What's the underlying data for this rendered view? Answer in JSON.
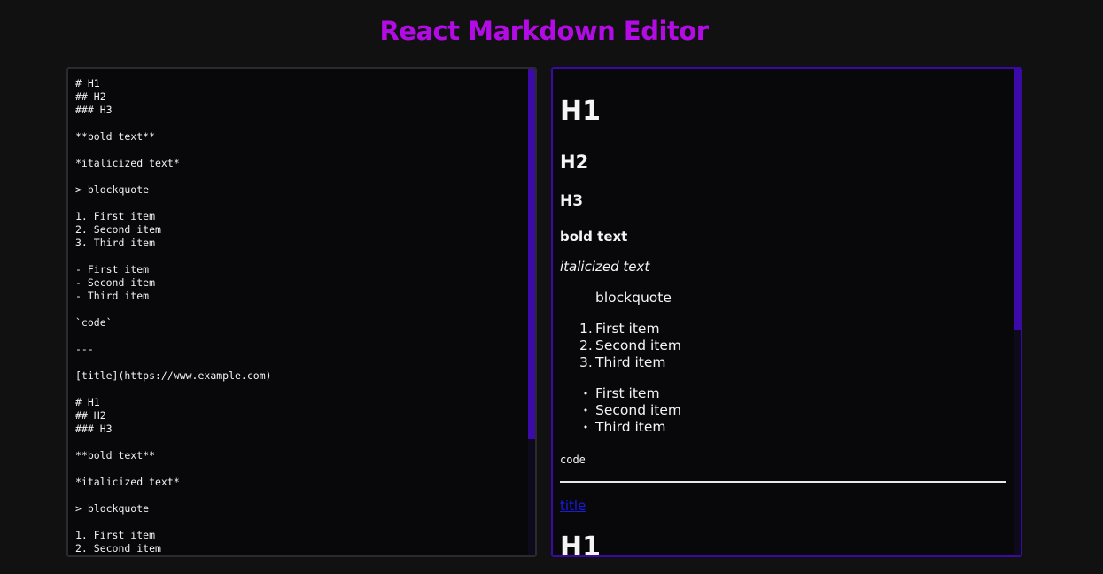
{
  "app": {
    "title": "React Markdown Editor"
  },
  "editor": {
    "text": "# H1\n## H2\n### H3\n\n**bold text**\n\n*italicized text*\n\n> blockquote\n\n1. First item\n2. Second item\n3. Third item\n\n- First item\n- Second item\n- Third item\n\n`code`\n\n---\n\n[title](https://www.example.com)\n\n# H1\n## H2\n### H3\n\n**bold text**\n\n*italicized text*\n\n> blockquote\n\n1. First item\n2. Second item"
  },
  "preview": {
    "h1": "H1",
    "h2": "H2",
    "h3": "H3",
    "bold": "bold text",
    "italic": "italicized text",
    "blockquote": "blockquote",
    "ordered": [
      {
        "marker": "1.",
        "text": "First item"
      },
      {
        "marker": "2.",
        "text": "Second item"
      },
      {
        "marker": "3.",
        "text": "Third item"
      }
    ],
    "unordered": [
      {
        "marker": "•",
        "text": "First item"
      },
      {
        "marker": "•",
        "text": "Second item"
      },
      {
        "marker": "•",
        "text": "Third item"
      }
    ],
    "code": "code",
    "link": "title",
    "h1_repeat": "H1"
  },
  "colors": {
    "background": "#111111",
    "title": "#b30be6",
    "accent": "#3b0aa8",
    "link": "#1a1ae6"
  }
}
